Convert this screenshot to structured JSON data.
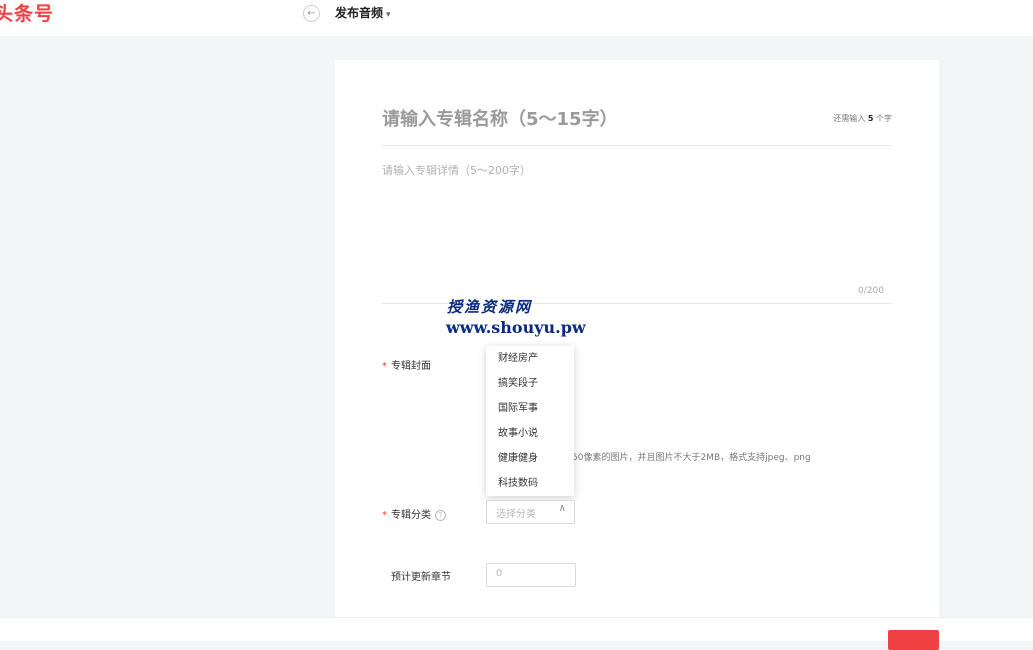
{
  "header": {
    "logo": "头条号",
    "breadcrumb": "发布音频",
    "caret": "▾",
    "back": "←"
  },
  "album": {
    "title_placeholder": "请输入专辑名称（5～15字）",
    "counter_prefix": "还需输入",
    "counter_value": "5",
    "counter_suffix": "个字",
    "detail_placeholder": "请输入专辑详情（5～200字）",
    "detail_count": "0/200"
  },
  "watermark": {
    "line1": "授渔资源网",
    "line2": "www.shouyu.pw"
  },
  "cover": {
    "required": "*",
    "label": "专辑封面",
    "hint": "50像素的图片，并且图片不大于2MB，格式支持jpeg、png"
  },
  "category": {
    "required": "*",
    "label": "专辑分类",
    "help": "?",
    "placeholder": "选择分类",
    "chevron": "∧",
    "options": [
      "财经房产",
      "搞笑段子",
      "国际军事",
      "故事小说",
      "健康健身",
      "科技数码"
    ]
  },
  "chapters": {
    "label": "预计更新章节",
    "value": "0"
  },
  "colors": {
    "brand": "#f04142"
  }
}
